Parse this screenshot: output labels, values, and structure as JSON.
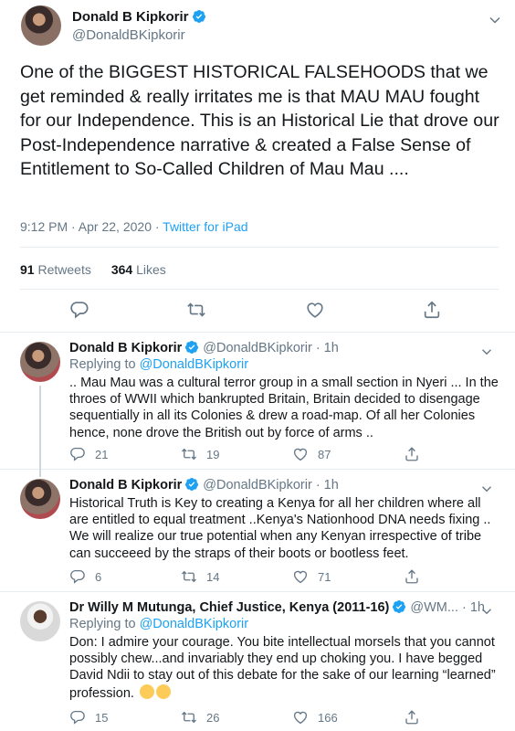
{
  "main_tweet": {
    "author_name": "Donald B Kipkorir",
    "author_handle": "@DonaldBKipkorir",
    "text": "One of the BIGGEST HISTORICAL FALSEHOODS that we get reminded & really irritates me is that MAU MAU fought for our Independence. This is an Historical Lie that drove our Post-Independence narrative & created a False Sense of Entitlement to So-Called Children of Mau Mau ....",
    "time": "9:12 PM · Apr 22, 2020 · ",
    "source": "Twitter for iPad",
    "retweets_count": "91",
    "retweets_label": "Retweets",
    "likes_count": "364",
    "likes_label": "Likes"
  },
  "replies": [
    {
      "author_name": "Donald B Kipkorir",
      "author_handle": "@DonaldBKipkorir",
      "time": "· 1h",
      "replying_prefix": "Replying to ",
      "replying_to": "@DonaldBKipkorir",
      "text": ".. Mau Mau was a cultural terror group in a small section in Nyeri ... In the throes of WWII which bankrupted Britain, Britain decided to disengage sequentially in all its Colonies & drew a road-map. Of all her Colonies hence, none drove the British out by force of arms ..",
      "reply_count": "21",
      "retweet_count": "19",
      "like_count": "87"
    },
    {
      "author_name": "Donald B Kipkorir",
      "author_handle": "@DonaldBKipkorir",
      "time": "· 1h",
      "text": "Historical Truth is Key to creating a Kenya for all her children where all are entitled to equal treatment ..Kenya's Nationhood DNA needs fixing .. We will realize our true potential when any Kenyan irrespective of tribe can succeeed by the straps of their boots or bootless feet.",
      "reply_count": "6",
      "retweet_count": "14",
      "like_count": "71"
    },
    {
      "author_name": "Dr Willy M Mutunga, Chief Justice, Kenya (2011-16)",
      "author_handle": "@WM...",
      "time": "· 1h",
      "replying_prefix": "Replying to ",
      "replying_to": "@DonaldBKipkorir",
      "text": "Don: I admire your courage. You bite intellectual morsels that you cannot possibly chew...and invariably they end up choking you. I have begged David Ndii to stay out of this debate for the sake of our learning “learned” profession.",
      "reply_count": "15",
      "retweet_count": "26",
      "like_count": "166"
    }
  ],
  "icons": {
    "verified": "verified-badge-icon",
    "reply": "reply-icon",
    "retweet": "retweet-icon",
    "like": "heart-icon",
    "share": "share-icon",
    "more": "chevron-down-icon"
  },
  "colors": {
    "accent": "#1da1f2",
    "muted": "#657786",
    "text": "#14171a",
    "divider": "#e6ecf0"
  }
}
